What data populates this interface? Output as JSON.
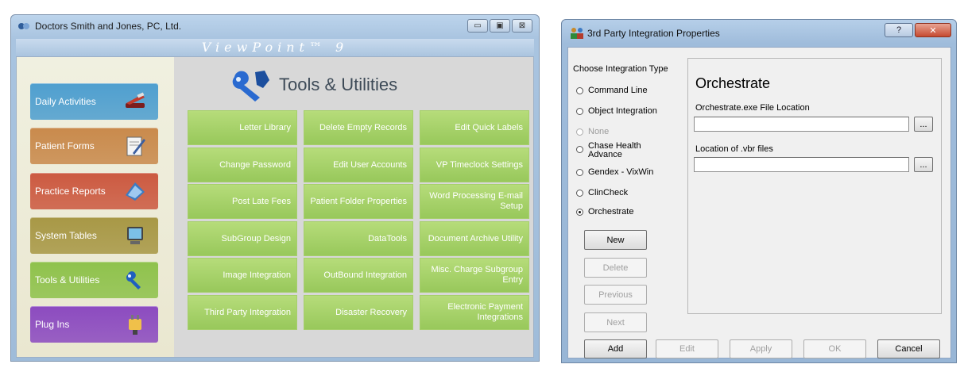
{
  "main_window": {
    "title": "Doctors Smith and Jones, PC, Ltd.",
    "banner": "ViewPoint™ 9",
    "section_title": "Tools & Utilities",
    "nav": [
      {
        "label": "Daily Activities",
        "color": "#4f9fcf"
      },
      {
        "label": "Patient Forms",
        "color": "#c98a4c"
      },
      {
        "label": "Practice Reports",
        "color": "#cc5a41"
      },
      {
        "label": "System Tables",
        "color": "#a89846"
      },
      {
        "label": "Tools & Utilities",
        "color": "#8fc24c"
      },
      {
        "label": "Plug Ins",
        "color": "#8c4bc0"
      }
    ],
    "tools": [
      [
        "Letter Library",
        "Delete Empty Records",
        "Edit Quick Labels"
      ],
      [
        "Change Password",
        "Edit User Accounts",
        "VP Timeclock Settings"
      ],
      [
        "Post Late Fees",
        "Patient Folder Properties",
        "Word Processing E-mail Setup"
      ],
      [
        "SubGroup Design",
        "DataTools",
        "Document Archive Utility"
      ],
      [
        "Image Integration",
        "OutBound Integration",
        "Misc. Charge Subgroup Entry"
      ],
      [
        "Third Party Integration",
        "Disaster Recovery",
        "Electronic Payment Integrations"
      ]
    ]
  },
  "dialog": {
    "title": "3rd Party Integration Properties",
    "help_label": "?",
    "close_label": "✕",
    "group_label": "Choose Integration Type",
    "options": [
      {
        "label": "Command Line",
        "selected": false,
        "enabled": true
      },
      {
        "label": "Object Integration",
        "selected": false,
        "enabled": true
      },
      {
        "label": "None",
        "selected": false,
        "enabled": false
      },
      {
        "label": "Chase Health Advance",
        "selected": false,
        "enabled": true
      },
      {
        "label": "Gendex - VixWin",
        "selected": false,
        "enabled": true
      },
      {
        "label": "ClinCheck",
        "selected": false,
        "enabled": true
      },
      {
        "label": "Orchestrate",
        "selected": true,
        "enabled": true
      }
    ],
    "side_buttons": {
      "new": "New",
      "delete": "Delete",
      "previous": "Previous",
      "next": "Next"
    },
    "detail": {
      "heading": "Orchestrate",
      "exe_label": "Orchestrate.exe File Location",
      "exe_value": "",
      "vbr_label": "Location of .vbr files",
      "vbr_value": "",
      "browse_label": "..."
    },
    "bottom_buttons": {
      "add": "Add",
      "edit": "Edit",
      "apply": "Apply",
      "ok": "OK",
      "cancel": "Cancel"
    }
  }
}
